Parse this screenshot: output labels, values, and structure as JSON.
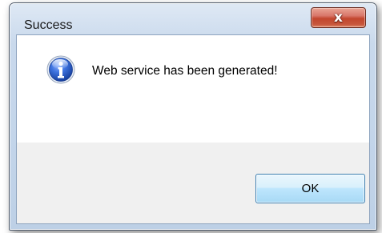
{
  "dialog": {
    "title": "Success",
    "close_glyph": "x",
    "message": "Web service has been generated!",
    "icon": "information-icon",
    "ok_label": "OK"
  },
  "colors": {
    "close_button": "#c7563c",
    "info_icon": "#2a5bd0",
    "ok_button_border": "#3c7fb1"
  }
}
